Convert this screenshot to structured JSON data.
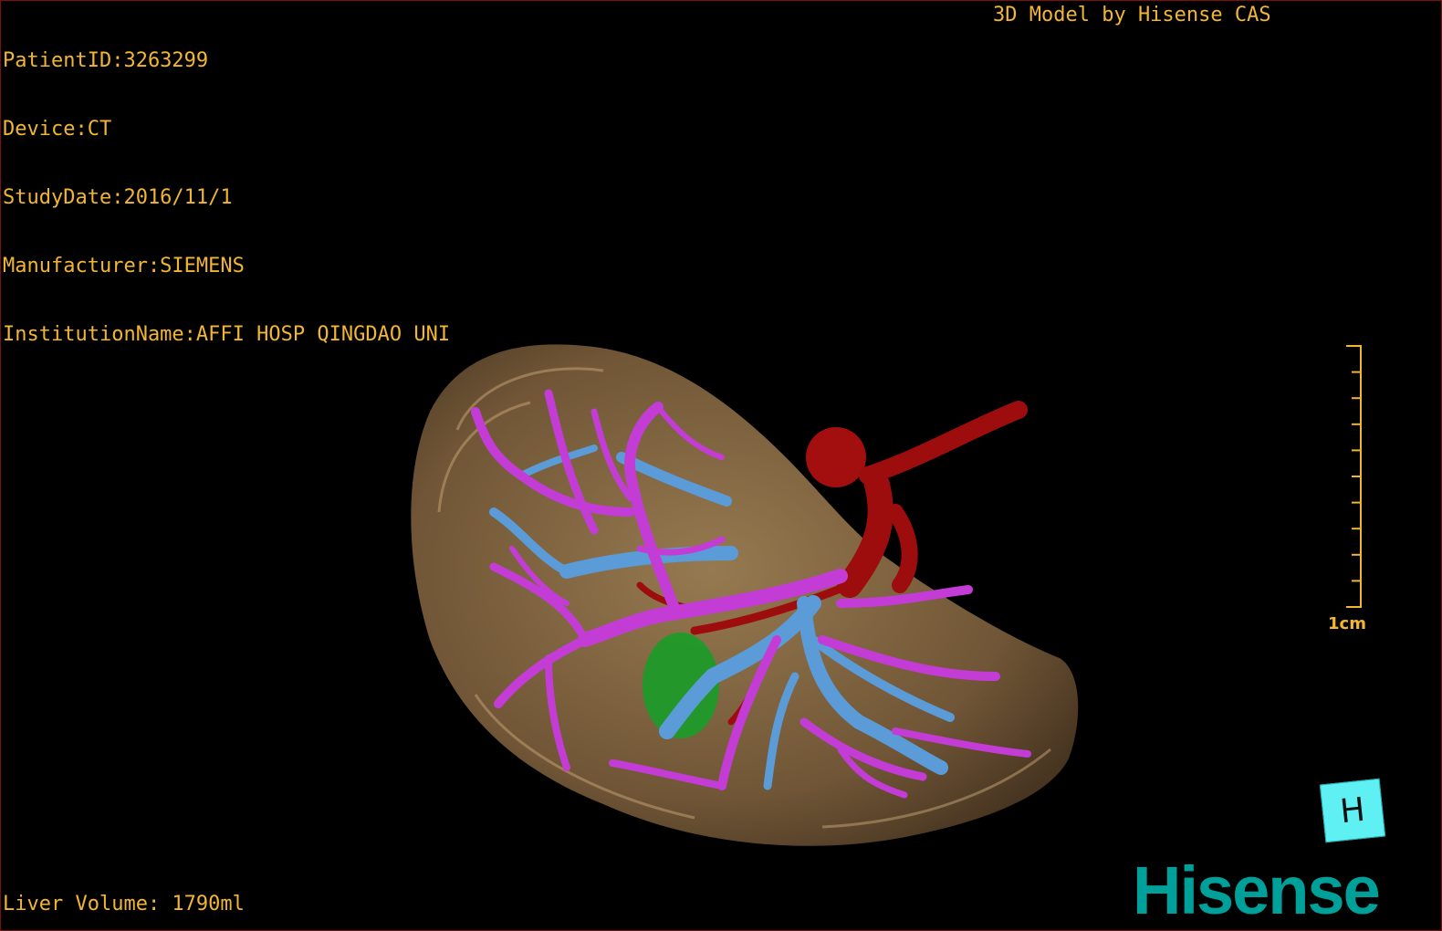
{
  "study": {
    "patient_id": "PatientID:3263299",
    "device": "Device:CT",
    "study_date": "StudyDate:2016/11/1",
    "manufacturer": "Manufacturer:SIEMENS",
    "institution": "InstitutionName:AFFI HOSP QINGDAO UNI"
  },
  "credit": "3D Model by Hisense CAS",
  "measurement": {
    "liver_volume": "Liver Volume: 1790ml"
  },
  "scale": {
    "label": "1cm",
    "ticks": 10
  },
  "orientation_cube": {
    "label": "H",
    "color": "#5ff0f4"
  },
  "logo": {
    "text": "Hisense",
    "color": "#00a09a"
  },
  "colors": {
    "overlay_text": "#f2b632",
    "liver_surface": "#8a6b45",
    "hepatic_vein": "#c43cd6",
    "portal_vein": "#5b9bd8",
    "artery": "#9e0d0d",
    "lesion": "#1f9a2a",
    "viewport_border": "#7a1010"
  }
}
